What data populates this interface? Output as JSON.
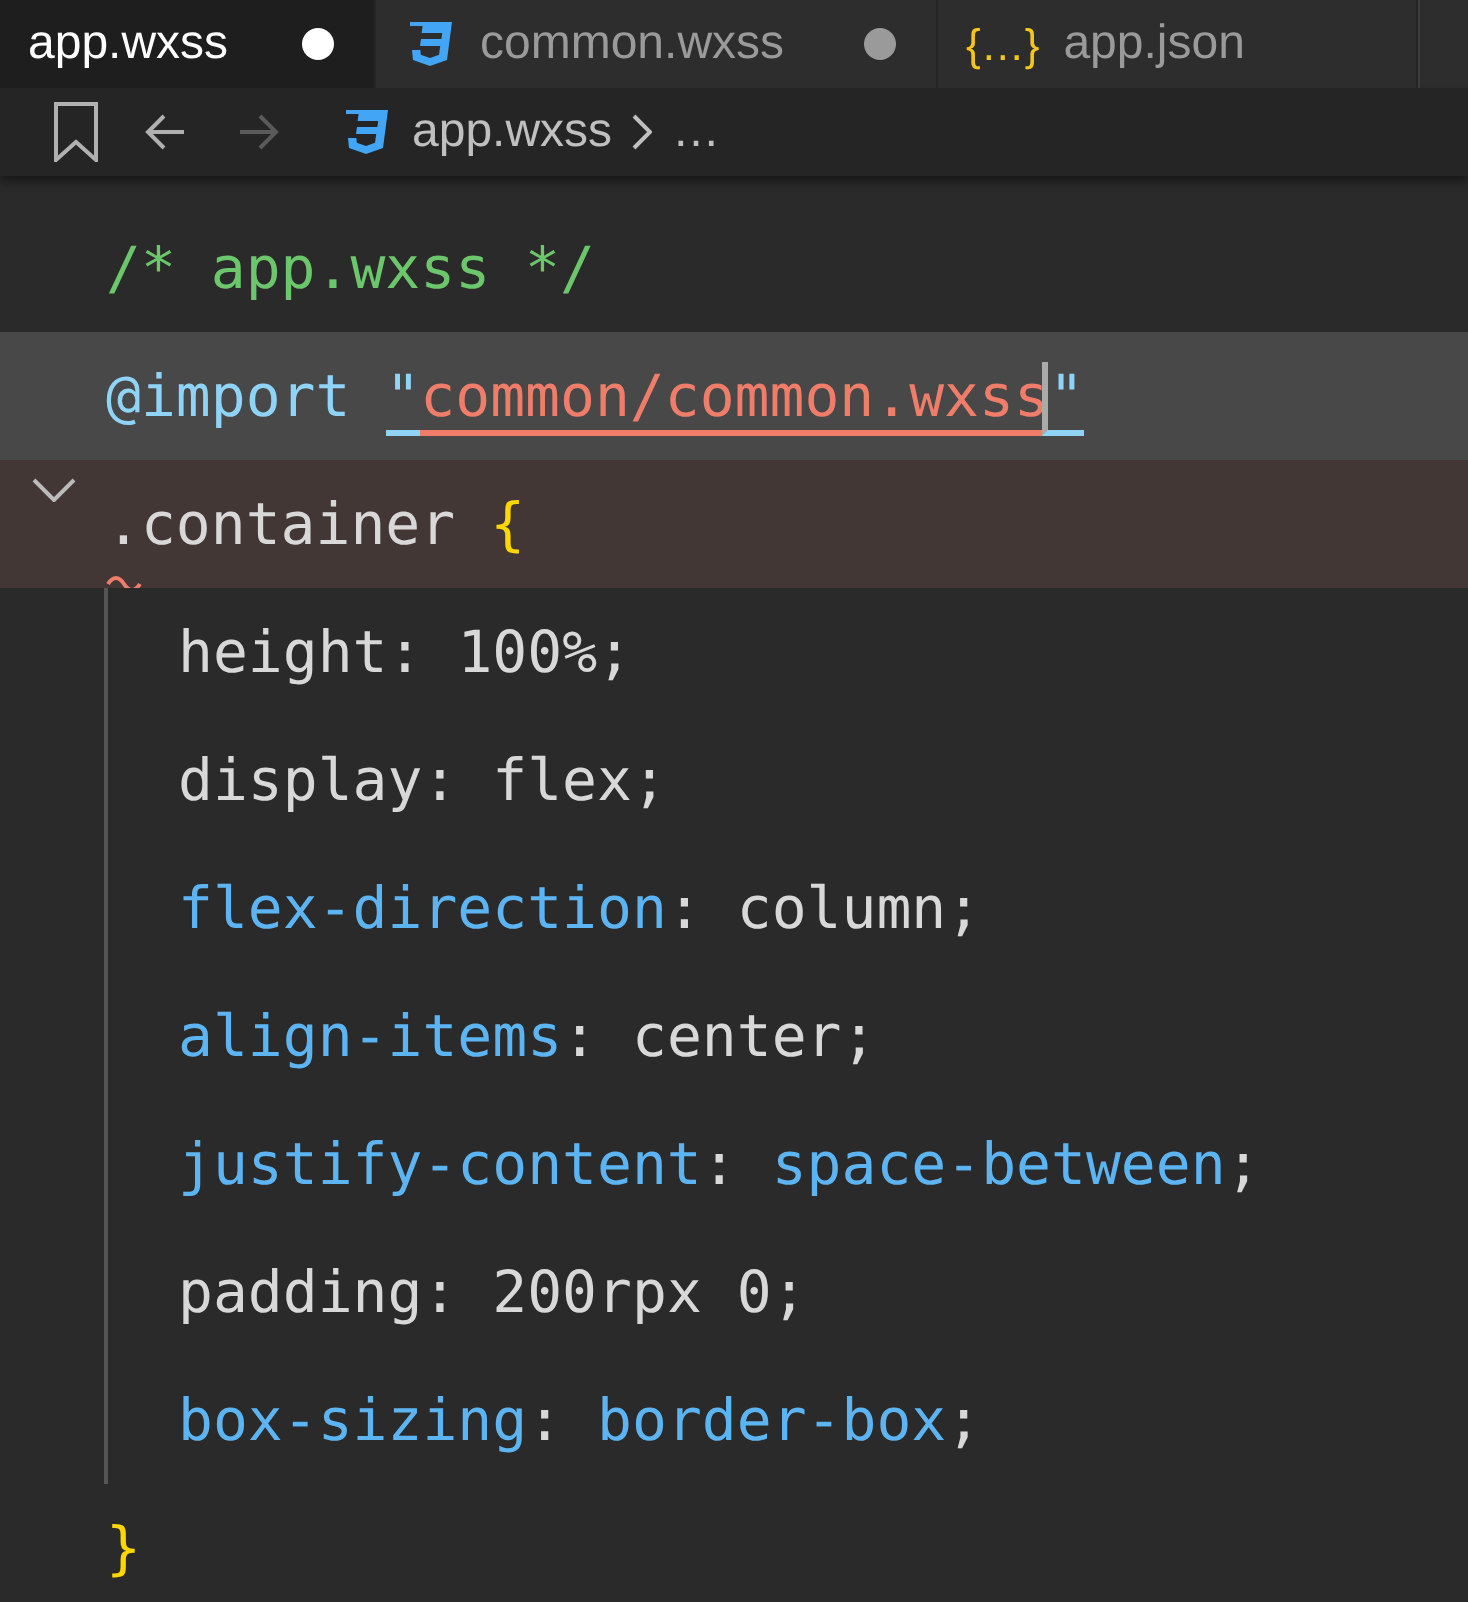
{
  "tabs": [
    {
      "label": "app.wxss",
      "kind": "plain",
      "selected": true,
      "modified": true
    },
    {
      "label": "common.wxss",
      "kind": "css",
      "selected": false,
      "modified": true
    },
    {
      "label": "app.json",
      "kind": "json",
      "icon_glyph": "{…}",
      "selected": false,
      "modified": false
    }
  ],
  "breadcrumb": {
    "back_disabled": false,
    "forward_disabled": true,
    "items": [
      "app.wxss",
      "…"
    ]
  },
  "lines": [
    {
      "tokens": [
        {
          "text": "/* app.wxss */",
          "kind": "comment"
        }
      ]
    },
    {
      "current": true,
      "tokens": [
        {
          "text": "@import ",
          "kind": "keyword"
        },
        {
          "text": "\"",
          "kind": "quote"
        },
        {
          "text": "common/common.wxss",
          "kind": "link"
        },
        {
          "text": "\"",
          "kind": "quote",
          "cursor_before": true
        }
      ]
    },
    {
      "matched": true,
      "expanded": true,
      "warning": true,
      "tokens": [
        {
          "text": ".container ",
          "kind": "plain"
        },
        {
          "text": "{",
          "kind": "brace"
        }
      ],
      "children": [
        {
          "tokens": [
            {
              "text": "height",
              "kind": "plain"
            },
            {
              "text": ": ",
              "kind": "plain"
            },
            {
              "text": "100%",
              "kind": "plain"
            },
            {
              "text": ";",
              "kind": "plain"
            }
          ]
        },
        {
          "tokens": [
            {
              "text": "display",
              "kind": "plain"
            },
            {
              "text": ": ",
              "kind": "plain"
            },
            {
              "text": "flex",
              "kind": "plain"
            },
            {
              "text": ";",
              "kind": "plain"
            }
          ]
        },
        {
          "tokens": [
            {
              "text": "flex-direction",
              "kind": "known"
            },
            {
              "text": ": ",
              "kind": "plain"
            },
            {
              "text": "column",
              "kind": "plain"
            },
            {
              "text": ";",
              "kind": "plain"
            }
          ]
        },
        {
          "tokens": [
            {
              "text": "align-items",
              "kind": "known"
            },
            {
              "text": ": ",
              "kind": "plain"
            },
            {
              "text": "center",
              "kind": "plain"
            },
            {
              "text": ";",
              "kind": "plain"
            }
          ]
        },
        {
          "tokens": [
            {
              "text": "justify-content",
              "kind": "known"
            },
            {
              "text": ": ",
              "kind": "plain"
            },
            {
              "text": "space-between",
              "kind": "known"
            },
            {
              "text": ";",
              "kind": "plain"
            }
          ]
        },
        {
          "tokens": [
            {
              "text": "padding",
              "kind": "plain"
            },
            {
              "text": ": ",
              "kind": "plain"
            },
            {
              "text": "200rpx 0",
              "kind": "plain"
            },
            {
              "text": ";",
              "kind": "plain"
            }
          ]
        },
        {
          "tokens": [
            {
              "text": "box-sizing",
              "kind": "known"
            },
            {
              "text": ": ",
              "kind": "plain"
            },
            {
              "text": "border-box",
              "kind": "known"
            },
            {
              "text": ";",
              "kind": "plain"
            }
          ]
        }
      ]
    },
    {
      "tokens": [
        {
          "text": "}",
          "kind": "brace"
        }
      ]
    }
  ]
}
